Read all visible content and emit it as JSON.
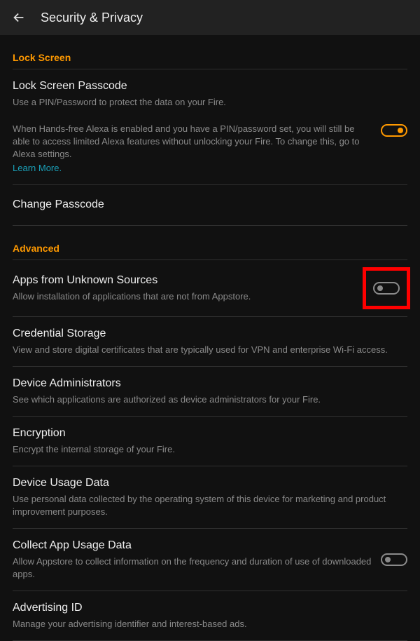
{
  "header": {
    "title": "Security & Privacy"
  },
  "sections": {
    "lock_screen": {
      "header": "Lock Screen",
      "passcode": {
        "title": "Lock Screen Passcode",
        "sub": "Use a PIN/Password to protect the data on your Fire."
      },
      "alexa_note": {
        "sub": "When Hands-free Alexa is enabled and you have a PIN/password set, you will still be able to access limited Alexa features without unlocking your Fire. To change this, go to Alexa settings.",
        "link": "Learn More.",
        "toggle_state": "on"
      },
      "change_passcode": {
        "title": "Change Passcode"
      }
    },
    "advanced": {
      "header": "Advanced",
      "unknown_sources": {
        "title": "Apps from Unknown Sources",
        "sub": "Allow installation of applications that are not from Appstore.",
        "toggle_state": "off"
      },
      "credential_storage": {
        "title": "Credential Storage",
        "sub": "View and store digital certificates that are typically used for VPN and enterprise Wi-Fi access."
      },
      "device_admins": {
        "title": "Device Administrators",
        "sub": "See which applications are authorized as device administrators for your Fire."
      },
      "encryption": {
        "title": "Encryption",
        "sub": "Encrypt the internal storage of your Fire."
      },
      "device_usage": {
        "title": "Device Usage Data",
        "sub": "Use personal data collected by the operating system of this device for marketing and product improvement purposes."
      },
      "collect_app_usage": {
        "title": "Collect App Usage Data",
        "sub": "Allow Appstore to collect information on the frequency and duration of use of downloaded apps.",
        "toggle_state": "off"
      },
      "advertising_id": {
        "title": "Advertising ID",
        "sub": "Manage your advertising identifier and interest-based ads."
      }
    }
  }
}
